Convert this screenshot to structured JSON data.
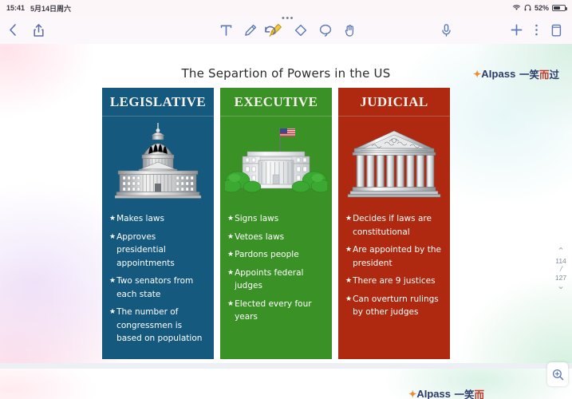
{
  "status_bar": {
    "time": "15:41",
    "date": "5月14日周六",
    "wifi_icon": "wifi-icon",
    "headphones_icon": "headphones-icon",
    "battery_percent": "52%",
    "battery_icon": "battery-icon"
  },
  "toolbar": {
    "back_icon": "chevron-left-icon",
    "share_icon": "share-icon",
    "undo_icon": "undo-icon",
    "more_dots_icon": "more-horizontal-icon",
    "tools": [
      {
        "name": "text-tool",
        "icon": "text-t-icon",
        "selected": false
      },
      {
        "name": "pen-tool",
        "icon": "pen-icon",
        "selected": false
      },
      {
        "name": "highlighter-tool",
        "icon": "highlighter-icon",
        "selected": true
      },
      {
        "name": "eraser-tool",
        "icon": "eraser-icon",
        "selected": false
      },
      {
        "name": "lasso-tool",
        "icon": "lasso-icon",
        "selected": false
      },
      {
        "name": "hand-tool",
        "icon": "hand-icon",
        "selected": false
      }
    ],
    "mic_icon": "microphone-icon",
    "add_icon": "plus-icon",
    "menu_icon": "more-vertical-icon",
    "pages_icon": "document-pages-icon"
  },
  "document": {
    "title": "The Separtion of Powers in the US",
    "watermark": {
      "brand": "AIpass",
      "suffix": "一笑而过",
      "star_icon": "star-icon"
    },
    "columns": [
      {
        "id": "legislative",
        "heading": "LEGISLATIVE",
        "color": "#15597e",
        "illustration": "capitol-building-illustration",
        "bullets": [
          "Makes laws",
          "Approves presidential appointments",
          "Two senators from each state",
          "The number of congressmen is based on population"
        ]
      },
      {
        "id": "executive",
        "heading": "EXECUTIVE",
        "color": "#3a9125",
        "illustration": "white-house-illustration",
        "bullets": [
          "Signs laws",
          "Vetoes laws",
          "Pardons people",
          "Appoints federal judges",
          "Elected every four years"
        ]
      },
      {
        "id": "judicial",
        "heading": "JUDICIAL",
        "color": "#ae2910",
        "illustration": "supreme-court-illustration",
        "bullets": [
          "Decides if laws are constitutional",
          "Are appointed by the president",
          "There are 9 justices",
          "Can overturn rulings by other judges"
        ]
      }
    ]
  },
  "pager": {
    "up_icon": "chevron-up-icon",
    "current_page": "114",
    "separator": "/",
    "total_pages": "127",
    "down_icon": "chevron-down-icon"
  },
  "next_page": {
    "watermark_brand": "AIpass",
    "watermark_suffix": "一笑而"
  },
  "zoom_button": {
    "icon": "zoom-in-icon"
  },
  "bullet_marker": "★"
}
